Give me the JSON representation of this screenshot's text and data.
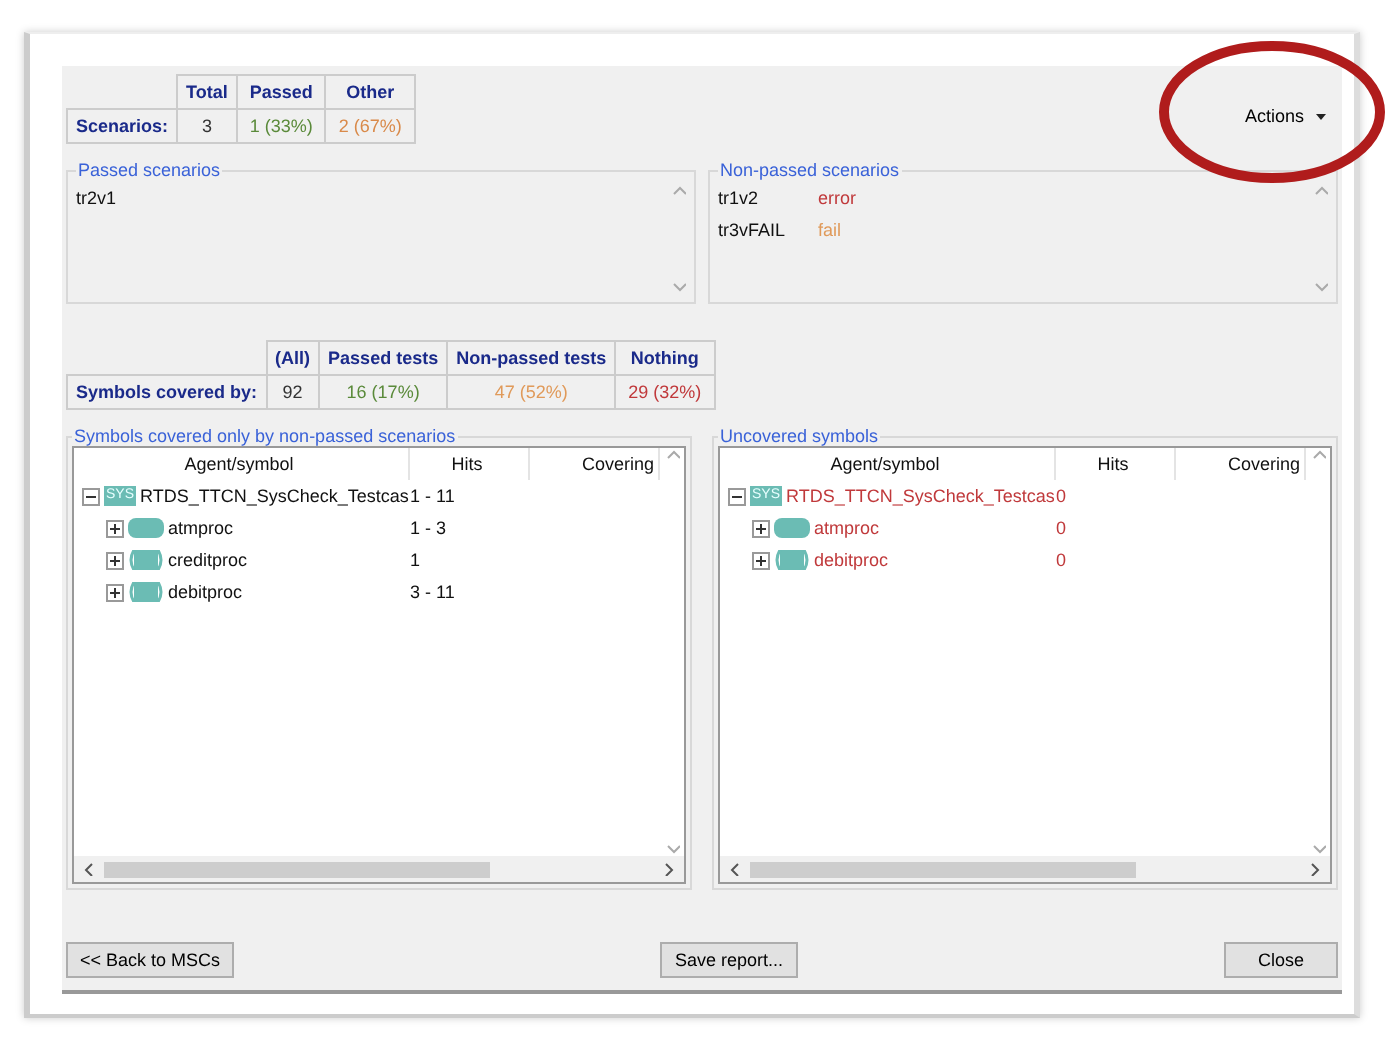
{
  "actions_menu": {
    "label": "Actions",
    "annotated": true
  },
  "scenario_table": {
    "columns": [
      "Total",
      "Passed",
      "Other"
    ],
    "row_label": "Scenarios:",
    "cells": [
      {
        "text": "3",
        "color": "#333333"
      },
      {
        "text": "1 (33%)",
        "color": "#5a8a3a"
      },
      {
        "text": "2 (67%)",
        "color": "#d98a4a"
      }
    ]
  },
  "passed_scenarios": {
    "title": "Passed scenarios",
    "items": [
      {
        "name": "tr2v1"
      }
    ]
  },
  "non_passed_scenarios": {
    "title": "Non-passed scenarios",
    "items": [
      {
        "name": "tr1v2",
        "status": "error",
        "color": "#c0393b"
      },
      {
        "name": "tr3vFAIL",
        "status": "fail",
        "color": "#e09a5a"
      }
    ]
  },
  "symbols_table": {
    "columns": [
      "(All)",
      "Passed tests",
      "Non-passed tests",
      "Nothing"
    ],
    "row_label": "Symbols covered by:",
    "cells": [
      {
        "text": "92",
        "color": "#333333"
      },
      {
        "text": "16 (17%)",
        "color": "#5a8a3a"
      },
      {
        "text": "47 (52%)",
        "color": "#e09a5a"
      },
      {
        "text": "29 (32%)",
        "color": "#c0393b"
      }
    ]
  },
  "trees": [
    {
      "title": "Symbols covered only by non-passed scenarios",
      "color": "#111111",
      "columns": [
        "Agent/symbol",
        "Hits",
        "Covering"
      ],
      "rows": [
        {
          "name": "RTDS_TTCN_SysCheck_Testcas",
          "hits": "1 - 11",
          "kind": "system",
          "badge": "SYS",
          "expanded": true,
          "children": [
            {
              "name": "atmproc",
              "hits": "1 - 3",
              "kind": "block",
              "expanded": false
            },
            {
              "name": "creditproc",
              "hits": "1",
              "kind": "process",
              "expanded": false
            },
            {
              "name": "debitproc",
              "hits": "3 - 11",
              "kind": "process",
              "expanded": false
            }
          ]
        }
      ]
    },
    {
      "title": "Uncovered symbols",
      "color": "#c0393b",
      "columns": [
        "Agent/symbol",
        "Hits",
        "Covering"
      ],
      "rows": [
        {
          "name": "RTDS_TTCN_SysCheck_Testcas",
          "hits": "0",
          "kind": "system",
          "badge": "SYS",
          "expanded": true,
          "children": [
            {
              "name": "atmproc",
              "hits": "0",
              "kind": "block",
              "expanded": false
            },
            {
              "name": "debitproc",
              "hits": "0",
              "kind": "process",
              "expanded": false
            }
          ]
        }
      ]
    }
  ],
  "buttons": {
    "back": "<< Back to MSCs",
    "save": "Save report...",
    "close": "Close"
  }
}
